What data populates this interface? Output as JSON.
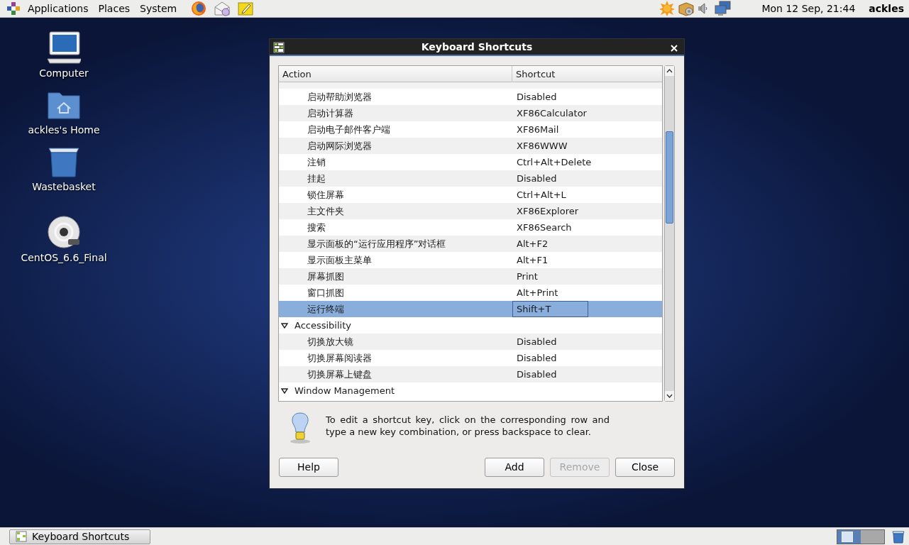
{
  "top_panel": {
    "menus": [
      {
        "label": "Applications"
      },
      {
        "label": "Places"
      },
      {
        "label": "System"
      }
    ],
    "clock": "Mon 12 Sep, 21:44",
    "user": "ackles"
  },
  "desktop_icons": [
    {
      "label": "Computer",
      "kind": "computer"
    },
    {
      "label": "ackles's Home",
      "kind": "home"
    },
    {
      "label": "Wastebasket",
      "kind": "trash"
    },
    {
      "label": "CentOS_6.6_Final",
      "kind": "disc"
    }
  ],
  "dialog": {
    "title": "Keyboard Shortcuts",
    "columns": [
      "Action",
      "Shortcut"
    ],
    "groups": [
      {
        "children": [
          {
            "action": "启动帮助浏览器",
            "shortcut": "Disabled",
            "selected": false,
            "editing": false
          },
          {
            "action": "启动计算器",
            "shortcut": "XF86Calculator",
            "selected": false,
            "editing": false
          },
          {
            "action": "启动电子邮件客户端",
            "shortcut": "XF86Mail",
            "selected": false,
            "editing": false
          },
          {
            "action": "启动网际浏览器",
            "shortcut": "XF86WWW",
            "selected": false,
            "editing": false
          },
          {
            "action": "注销",
            "shortcut": "Ctrl+Alt+Delete",
            "selected": false,
            "editing": false
          },
          {
            "action": "挂起",
            "shortcut": "Disabled",
            "selected": false,
            "editing": false
          },
          {
            "action": "锁住屏幕",
            "shortcut": "Ctrl+Alt+L",
            "selected": false,
            "editing": false
          },
          {
            "action": "主文件夹",
            "shortcut": "XF86Explorer",
            "selected": false,
            "editing": false
          },
          {
            "action": "搜索",
            "shortcut": "XF86Search",
            "selected": false,
            "editing": false
          },
          {
            "action": "显示面板的“运行应用程序”对话框",
            "shortcut": "Alt+F2",
            "selected": false,
            "editing": false
          },
          {
            "action": "显示面板主菜单",
            "shortcut": "Alt+F1",
            "selected": false,
            "editing": false
          },
          {
            "action": "屏幕抓图",
            "shortcut": "Print",
            "selected": false,
            "editing": false
          },
          {
            "action": "窗口抓图",
            "shortcut": "Alt+Print",
            "selected": false,
            "editing": false
          },
          {
            "action": "运行终端",
            "shortcut": "Shift+T",
            "selected": true,
            "editing": true
          }
        ]
      },
      {
        "label": "Accessibility",
        "expanded": true,
        "children": [
          {
            "action": "切换放大镜",
            "shortcut": "Disabled",
            "selected": false,
            "editing": false
          },
          {
            "action": "切换屏幕阅读器",
            "shortcut": "Disabled",
            "selected": false,
            "editing": false
          },
          {
            "action": "切换屏幕上键盘",
            "shortcut": "Disabled",
            "selected": false,
            "editing": false
          }
        ]
      },
      {
        "label": "Window Management",
        "expanded": true
      }
    ],
    "hint": "To edit a shortcut key, click on the corresponding row and type a new key combination, or press backspace to clear.",
    "buttons": [
      {
        "label": "Help",
        "disabled": false
      },
      {
        "label": "Add",
        "disabled": false
      },
      {
        "label": "Remove",
        "disabled": true
      },
      {
        "label": "Close",
        "disabled": false
      }
    ]
  },
  "taskbar": {
    "windows": [
      {
        "label": "Keyboard Shortcuts",
        "selected": false
      }
    ],
    "workspaces": [
      {
        "selected": true
      },
      {
        "selected": false
      }
    ]
  }
}
